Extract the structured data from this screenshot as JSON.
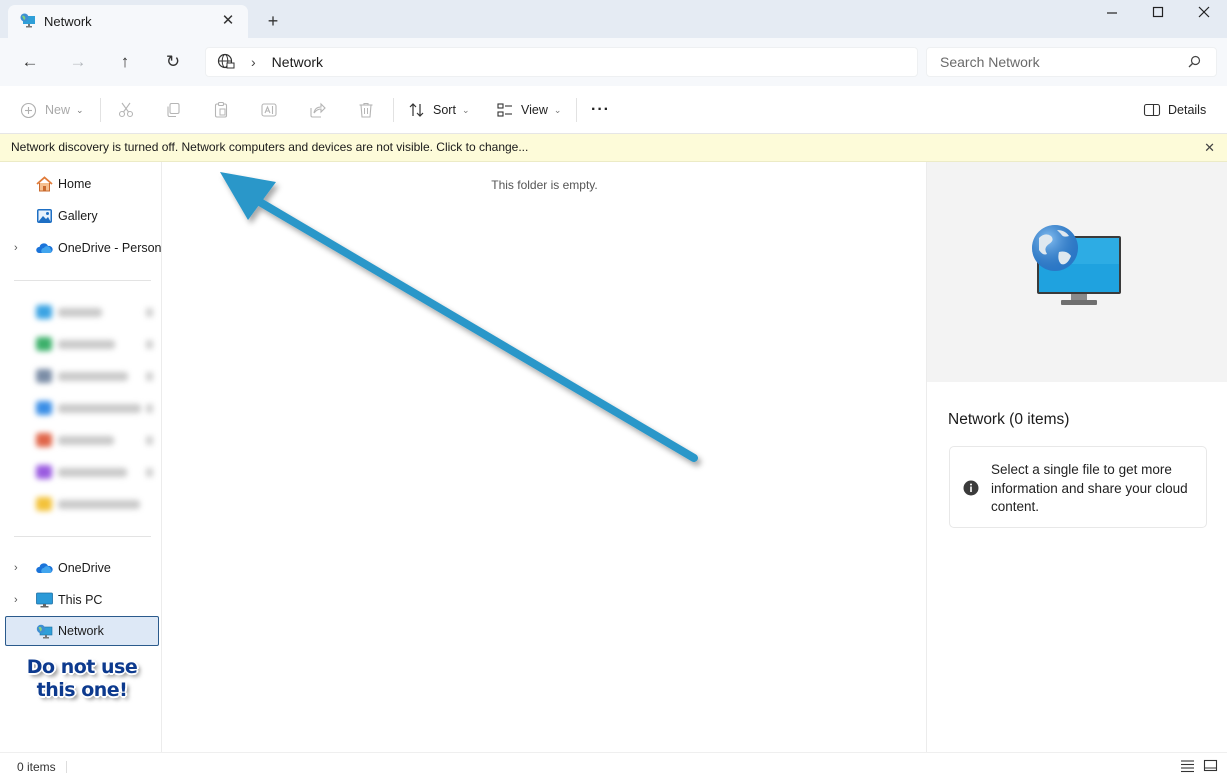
{
  "window": {
    "tab_title": "Network",
    "tab_close": "✕",
    "new_tab": "+",
    "minimize": "—",
    "maximize": "☐",
    "close": "✕"
  },
  "nav": {
    "back": "←",
    "forward": "→",
    "up": "↑",
    "refresh": "↻"
  },
  "address": {
    "separator": "›",
    "crumb": "Network"
  },
  "search": {
    "placeholder": "Search Network"
  },
  "toolbar": {
    "new_label": "New",
    "sort_label": "Sort",
    "view_label": "View",
    "more_label": "···",
    "details_label": "Details",
    "caret": "⌄"
  },
  "infobar": {
    "message": "Network discovery is turned off. Network computers and devices are not visible. Click to change...",
    "close": "✕"
  },
  "sidebar": {
    "items_top": [
      {
        "label": "Home",
        "icon": "home-icon"
      },
      {
        "label": "Gallery",
        "icon": "gallery-icon"
      },
      {
        "label": "OneDrive - Persona",
        "icon": "onedrive-cloud-icon",
        "chevron": "›"
      }
    ],
    "blurred_colors": [
      "#3aa3e3",
      "#3cb06a",
      "#7b8da6",
      "#3a8ee6",
      "#e0664a",
      "#9a5be0",
      "#f3c23a"
    ],
    "items_bottom": [
      {
        "label": "OneDrive",
        "icon": "onedrive-cloud-icon",
        "chevron": "›"
      },
      {
        "label": "This PC",
        "icon": "this-pc-icon",
        "chevron": "›"
      },
      {
        "label": "Network",
        "icon": "network-icon",
        "selected": true
      }
    ],
    "warning_line1": "Do not use",
    "warning_line2": "this one!"
  },
  "content": {
    "empty_message": "This folder is empty.",
    "arrow_color": "#2a97c9"
  },
  "details": {
    "title": "Network (0 items)",
    "message": "Select a single file to get more information and share your cloud content."
  },
  "status": {
    "item_count": "0 items"
  }
}
